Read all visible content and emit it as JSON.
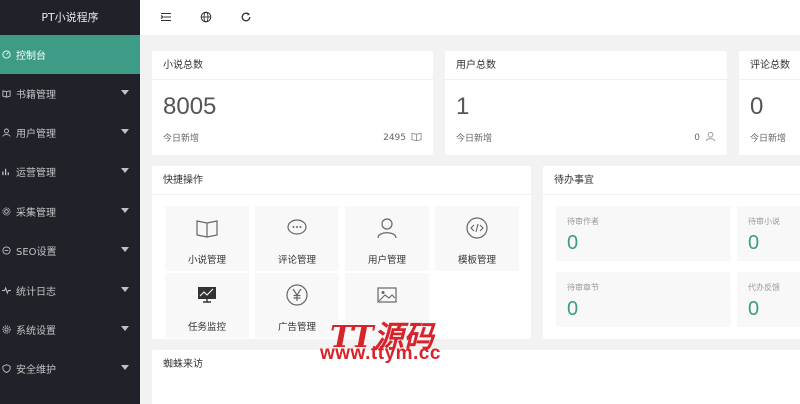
{
  "app": {
    "title": "PT小说程序"
  },
  "sidebar": {
    "items": [
      {
        "label": "控制台",
        "icon": "dashboard-icon",
        "active": true
      },
      {
        "label": "书籍管理",
        "icon": "book-icon"
      },
      {
        "label": "用户管理",
        "icon": "user-icon"
      },
      {
        "label": "运营管理",
        "icon": "chart-icon"
      },
      {
        "label": "采集管理",
        "icon": "gear-icon"
      },
      {
        "label": "SEO设置",
        "icon": "seo-icon"
      },
      {
        "label": "统计日志",
        "icon": "pulse-icon"
      },
      {
        "label": "系统设置",
        "icon": "settings-icon"
      },
      {
        "label": "安全维护",
        "icon": "shield-icon"
      }
    ]
  },
  "header": {
    "icons": [
      "menu-fold-icon",
      "globe-icon",
      "refresh-icon"
    ]
  },
  "stats": [
    {
      "title": "小说总数",
      "value": "8005",
      "sub": "今日新增",
      "today": "2495"
    },
    {
      "title": "用户总数",
      "value": "1",
      "sub": "今日新增",
      "today": "0"
    },
    {
      "title": "评论总数",
      "value": "0",
      "sub": "今日新增"
    }
  ],
  "quick": {
    "title": "快捷操作",
    "tiles": [
      {
        "label": "小说管理",
        "icon": "book-icon"
      },
      {
        "label": "评论管理",
        "icon": "chat-icon"
      },
      {
        "label": "用户管理",
        "icon": "user-icon"
      },
      {
        "label": "模板管理",
        "icon": "code-icon"
      },
      {
        "label": "任务监控",
        "icon": "monitor-icon"
      },
      {
        "label": "广告管理",
        "icon": "yen-icon"
      },
      {
        "label": "",
        "icon": "image-icon"
      }
    ]
  },
  "pending": {
    "title": "待办事宜",
    "items": [
      {
        "label": "待审作者",
        "value": "0"
      },
      {
        "label": "待审小说",
        "value": "0"
      },
      {
        "label": "待审章节",
        "value": "0"
      },
      {
        "label": "代办反馈",
        "value": "0"
      }
    ]
  },
  "spider": {
    "title": "蜘蛛来访"
  },
  "watermark": {
    "line1": "TT源码",
    "line2": "www.ttym.cc"
  },
  "colors": {
    "sidebar": "#20222a",
    "accent": "#3d9c86",
    "watermark": "#d9232a"
  }
}
